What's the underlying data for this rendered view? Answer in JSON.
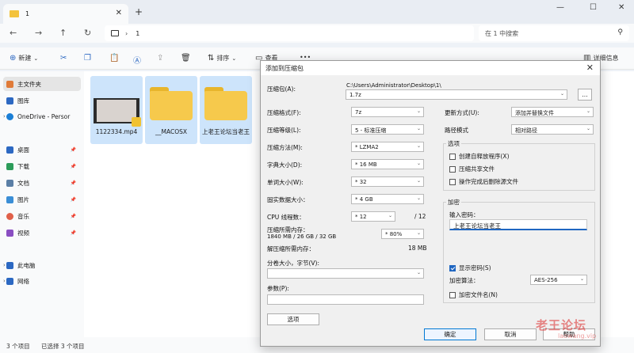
{
  "explorer": {
    "tab_title": "1",
    "new_tab": "+",
    "address": {
      "path": "1"
    },
    "search_placeholder": "在 1 中搜索",
    "toolbar": {
      "new_label": "新建",
      "sort_label": "排序",
      "view_label": "查看",
      "more_label": "•••",
      "details_label": "详细信息"
    },
    "sidebar": {
      "items": [
        {
          "label": "主文件夹",
          "icon": "home-icon",
          "color": "#e07b39"
        },
        {
          "label": "图库",
          "icon": "gallery-icon",
          "color": "#2c68c2"
        },
        {
          "label": "OneDrive - Persor",
          "icon": "cloud-icon",
          "color": "#1b7fd6"
        },
        {
          "label": "桌面",
          "icon": "desktop-icon",
          "color": "#2c68c2"
        },
        {
          "label": "下载",
          "icon": "download-icon",
          "color": "#2c9c5a"
        },
        {
          "label": "文档",
          "icon": "document-icon",
          "color": "#5b7fa6"
        },
        {
          "label": "图片",
          "icon": "pictures-icon",
          "color": "#3a8ed6"
        },
        {
          "label": "音乐",
          "icon": "music-icon",
          "color": "#e0604a"
        },
        {
          "label": "视频",
          "icon": "video-icon",
          "color": "#8a4ec2"
        },
        {
          "label": "此电脑",
          "icon": "pc-icon",
          "color": "#2c68c2"
        },
        {
          "label": "网络",
          "icon": "network-icon",
          "color": "#2c68c2"
        }
      ]
    },
    "files": [
      {
        "name": "1122334.mp4",
        "type": "video"
      },
      {
        "name": "__MACOSX",
        "type": "folder"
      },
      {
        "name": "上老王论坛当老王",
        "type": "folder"
      }
    ],
    "status": {
      "count": "3 个项目",
      "selected": "已选择 3 个项目"
    }
  },
  "dialog": {
    "title": "添加到压缩包",
    "archive_label": "压缩包(A):",
    "archive_dir": "C:\\Users\\Administrator\\Desktop\\1\\",
    "archive_name": "1.7z",
    "browse_button": "...",
    "left": {
      "format": {
        "label": "压缩格式(F):",
        "value": "7z"
      },
      "level": {
        "label": "压缩等级(L):",
        "value": "5 - 标准压缩"
      },
      "method": {
        "label": "压缩方法(M):",
        "value": "* LZMA2"
      },
      "dict": {
        "label": "字典大小(D):",
        "value": "* 16 MB"
      },
      "word": {
        "label": "单词大小(W):",
        "value": "* 32"
      },
      "solid": {
        "label": "固实数据大小：",
        "value": "* 4 GB"
      },
      "threads": {
        "label": "CPU 线程数：",
        "value": "* 12",
        "max": "/ 12"
      },
      "mem_compress_label": "压缩所需内存：",
      "mem_compress_detail": "1840 MB / 26 GB / 32 GB",
      "mem_percent": "* 80%",
      "mem_decompress_label": "解压缩所需内存：",
      "mem_decompress_value": "18 MB",
      "split_label": "分卷大小，字节(V):",
      "params_label": "参数(P):",
      "options_button": "选项"
    },
    "right": {
      "update_label": "更新方式(U):",
      "update_value": "添加并替换文件",
      "path_label": "路径模式",
      "path_value": "相对路径",
      "options_group": "选项",
      "opt_sfx": "创建自释放程序(X)",
      "opt_shared": "压缩共享文件",
      "opt_delete": "操作完成后删除源文件",
      "encrypt_group": "加密",
      "password_label": "输入密码：",
      "password_value": "上老王论坛当老王",
      "show_password": "显示密码(S)",
      "enc_method_label": "加密算法：",
      "enc_method_value": "AES-256",
      "encrypt_names": "加密文件名(N)"
    },
    "buttons": {
      "ok": "确定",
      "cancel": "取消",
      "help": "帮助"
    }
  },
  "watermark": {
    "main": "老王论坛",
    "sub": "laowang.vip"
  }
}
